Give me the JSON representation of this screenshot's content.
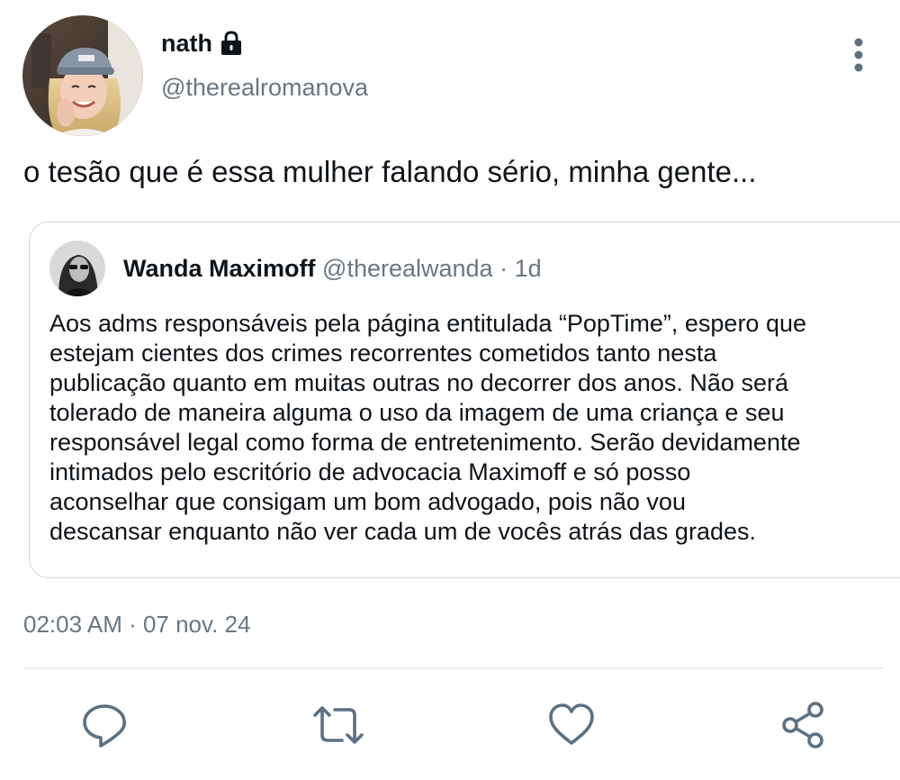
{
  "tweet": {
    "author": {
      "display_name": "nath",
      "handle": "@therealromanova",
      "avatar_icon": "profile-photo",
      "protected_icon": "lock-icon"
    },
    "text": "o tesão que é essa mulher falando sério, minha gente...",
    "quoted": {
      "display_name": "Wanda Maximoff",
      "handle": "@therealwanda",
      "separator": "·",
      "relative_time": "1d",
      "body_lines": [
        "Aos adms responsáveis pela página entitulada “PopTime”, espero que",
        "estejam cientes dos crimes recorrentes cometidos tanto nesta",
        "publicação quanto em muitas outras no decorrer dos anos. Não será",
        "tolerado de maneira alguma o uso da imagem de uma criança e seu",
        "responsável legal como forma de entretenimento. Serão devidamente",
        "intimados pelo escritório de advocacia Maximoff e só posso",
        "aconselhar que consigam um bom advogado, pois não vou",
        "descansar enquanto não ver cada um de vocês atrás das grades."
      ]
    },
    "timestamp": "02:03 AM · 07 nov. 24"
  },
  "actions": [
    {
      "name": "reply-icon"
    },
    {
      "name": "retweet-icon"
    },
    {
      "name": "like-icon"
    },
    {
      "name": "share-icon"
    }
  ],
  "colors": {
    "text": "#0f1419",
    "secondary": "#687684",
    "border": "#cfd9de",
    "icon": "#5b7083"
  }
}
